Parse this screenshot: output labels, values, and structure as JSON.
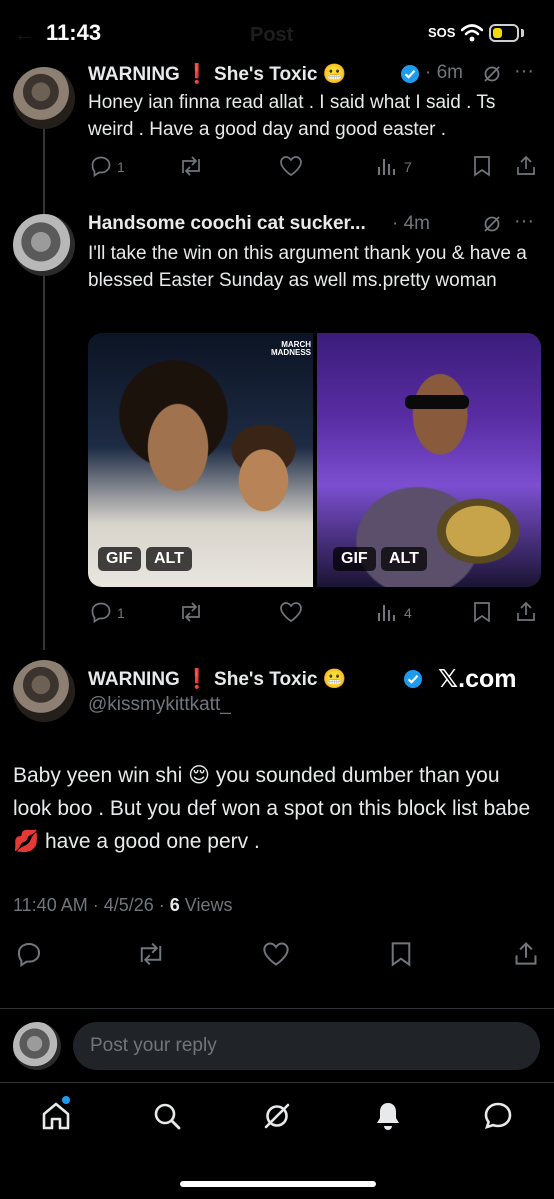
{
  "status_bar": {
    "time": "11:43",
    "sos": "SOS",
    "header_faded": "Post",
    "battery_level": 0.4
  },
  "tweet1": {
    "display_name": "WARNING ❗ She's Toxic 😬",
    "time": "· 6m",
    "text": "Honey ian finna read allat . I said what I said . Ts weird . Have a good day and good easter .",
    "replies": "1",
    "views": "7"
  },
  "tweet2": {
    "display_name": "Handsome coochi cat sucker...",
    "time": "· 4m",
    "text": "I'll take the win on this argument thank you & have a blessed Easter Sunday as well ms.pretty woman",
    "media": [
      {
        "badge": "GIF",
        "alt": "ALT",
        "overlay": "MARCH MADNESS"
      },
      {
        "badge": "GIF",
        "alt": "ALT"
      }
    ],
    "replies": "1",
    "views": "4"
  },
  "main_tweet": {
    "display_name": "WARNING ❗ She's Toxic 😬",
    "handle": "@kissmykittkatt_",
    "watermark": "𝕏.com",
    "text": "Baby yeen win shi 😌 you sounded dumber than you look boo . But you def won a spot on this block list babe 💋 have a good one perv .",
    "timestamp": "11:40 AM · 4/5/26 · ",
    "views_count": "6",
    "views_label": " Views"
  },
  "reply": {
    "placeholder": "Post your reply"
  },
  "colors": {
    "accent": "#1d9bf0",
    "background": "#000000",
    "muted": "#71767b"
  },
  "icons": [
    "reply-icon",
    "repost-icon",
    "like-icon",
    "views-icon",
    "bookmark-icon",
    "share-icon",
    "grok-icon",
    "more-icon",
    "verified-icon",
    "home-icon",
    "search-icon",
    "notifications-icon",
    "messages-icon"
  ]
}
